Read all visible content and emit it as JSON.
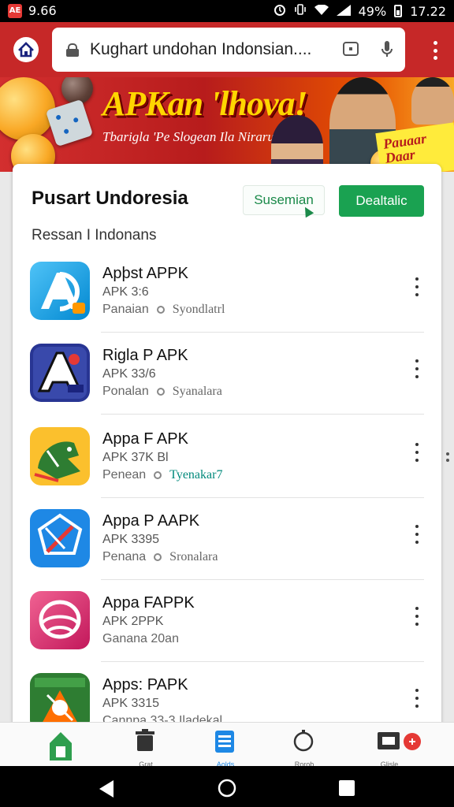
{
  "status_bar": {
    "time_left": "9.66",
    "battery": "49%",
    "time_right": "17.22",
    "notif_icon_text": "AE"
  },
  "browser": {
    "url_text": "Kughart undohan Indonsian....",
    "home_icon": "home-icon",
    "lock_icon": "lock-icon",
    "tab_icon": "tab-switch-icon",
    "mic_icon": "mic-icon",
    "menu_icon": "more-vert-icon"
  },
  "banner": {
    "title": "APKan 'lhova!",
    "subtitle": "Tbarigla 'Pe Slogean Ila Nirarue",
    "sticker_line1": "Pauaar",
    "sticker_line2": "Daar"
  },
  "card": {
    "title": "Pusart Undoresia",
    "secondary_button": "Susemian",
    "primary_button": "Dealtalic",
    "subheading": "Ressan I Indonans"
  },
  "apps": [
    {
      "name": "Apþst APPK",
      "version": "APK 3:6",
      "meta_a": "Panaian",
      "meta_b": "Syondlatrl",
      "icon": "blue-a-logo-icon"
    },
    {
      "name": "Rigla P APK",
      "version": "APK 33/6",
      "meta_a": "Ponalan",
      "meta_b": "Syanalara",
      "icon": "navy-a-logo-icon"
    },
    {
      "name": "Appa F APK",
      "version": "APK 37K Bl",
      "meta_a": "Penean",
      "meta_b": "Tyenakar7",
      "icon": "green-bird-logo-icon"
    },
    {
      "name": "Appa P AAPK",
      "version": "APK 3395",
      "meta_a": "Penana",
      "meta_b": "Sronalara",
      "icon": "blue-compass-logo-icon"
    },
    {
      "name": "Appa FAPPK",
      "version": "APK 2PPK",
      "meta_a": "Ganana 20an",
      "meta_b": "",
      "icon": "pink-shell-logo-icon"
    },
    {
      "name": "Apps: PAPK",
      "version": "APK 3315",
      "meta_a": "Cannpa 33-3 Iladekal",
      "meta_b": "",
      "icon": "green-pinwheel-logo-icon"
    }
  ],
  "bottom_nav": [
    {
      "label": "",
      "icon": "home-icon",
      "active": false
    },
    {
      "label": "Grat",
      "icon": "trash-icon",
      "active": false
    },
    {
      "label": "Aolds",
      "icon": "list-icon",
      "active": true
    },
    {
      "label": "Rorob",
      "icon": "circle-icon",
      "active": false
    },
    {
      "label": "Glisle",
      "icon": "profile-icon",
      "active": false
    }
  ],
  "colors": {
    "toolbar_red": "#c62828",
    "primary_green": "#1aa251",
    "accent_blue": "#1e88e5"
  }
}
